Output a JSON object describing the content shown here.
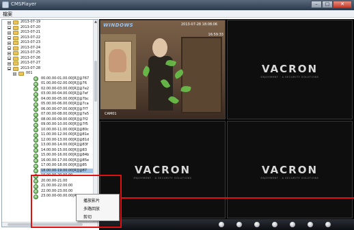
{
  "window": {
    "title": "CMSPlayer",
    "buttons": [
      "–",
      "□",
      "✕"
    ]
  },
  "menu": {
    "items": [
      "檔案"
    ]
  },
  "tree": {
    "dates": [
      "2013-07-19",
      "2013-07-20",
      "2013-07-21",
      "2013-07-22",
      "2013-07-23",
      "2013-07-24",
      "2013-07-25",
      "2013-07-26",
      "2013-07-27",
      "2013-07-28"
    ],
    "channel": "001",
    "recordings": [
      "00.00.00-01.00.00[R][@767",
      "01.00.00-02.00.00[R][@76",
      "02.00.00-03.00.00[R][@7e2",
      "03.00.00-04.00.00[R][@7ef",
      "04.00.00-05.00.00[R][@7bc",
      "05.00.00-06.00.00[R][@7ca",
      "06.00.00-07.00.00[R][@7f7",
      "07.00.00-08.00.00[R][@7e5",
      "08.00.00-09.00.00[R][@7f2",
      "09.00.00-10.00.00[R][@7f5",
      "10.00.00-11.00.00[R][@80c",
      "11.00.00-12.00.00[R][@81e",
      "12.00.00-13.00.00[R][@81d",
      "13.00.00-14.00.00[R][@83f",
      "14.00.00-15.00.00[R][@83",
      "15.00.00-16.00.00[R][@84b",
      "16.00.00-17.00.00[R][@85e",
      "17.00.00-18.00.00[R][@85",
      "18.00.00-19.00.00[R][@87",
      "19.00.00-20.00.00",
      "20.00.00-21.00",
      "21.00.00-22.00.00",
      "22.00.00-23.00.00",
      "23.00.00-00.00.00[R][@8b6"
    ],
    "selected_recording_index": 18
  },
  "video": {
    "live": {
      "logo": "WINDOWS",
      "date": "2013-07-28 18:08:06",
      "time": "16:59:33",
      "camera": "CAM01"
    },
    "brand": {
      "name": "VACRON",
      "tagline": "ENJOYMENT · A SECURITY SOLUTIONS"
    }
  },
  "context_menu": {
    "items": [
      "播放影片",
      "多路回放",
      "剪切"
    ]
  },
  "toolbar": {
    "buttons": [
      "play-icon",
      "pause-icon",
      "stop-icon",
      "prev-icon",
      "next-icon",
      "snapshot-icon",
      "volume-icon"
    ]
  },
  "colors": {
    "highlight": "#e01010",
    "folder": "#e8c45a",
    "selection": "#9ec4ea"
  }
}
